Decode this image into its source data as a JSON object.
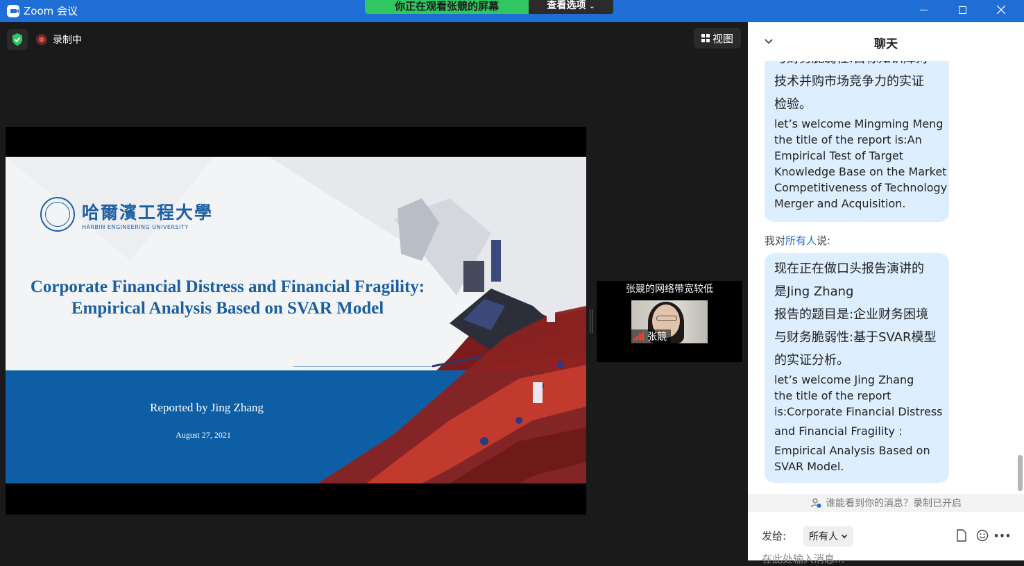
{
  "titlebar": {
    "app_title": "Zoom 会议",
    "share_banner": "你正在观看张競的屏幕",
    "view_options": "查看选项"
  },
  "toolbar": {
    "recording_label": "录制中",
    "view_label": "视图"
  },
  "slide": {
    "university_cn": "哈爾濱工程大學",
    "university_en": "HARBIN ENGINEERING UNIVERSITY",
    "title_line1": "Corporate Financial Distress and Financial Fragility:",
    "title_line2": "Empirical Analysis Based on SVAR Model",
    "reported_by": "Reported by Jing Zhang",
    "date": "August 27, 2021"
  },
  "participant": {
    "network_warning": "张競的网络带宽较低",
    "name": "张競"
  },
  "chat": {
    "title": "聊天",
    "message1_lines_cn": [
      "与财务脆弱性:目标知识库对",
      "技术并购市场竞争力的实证",
      "检验。"
    ],
    "message1_lines_en": [
      "let’s welcome Mingming Meng",
      "the title of the report is:An",
      "Empirical Test of Target",
      "Knowledge Base on the Market",
      "Competitiveness of Technology",
      "Merger and Acquisition."
    ],
    "sender_prefix": "我对",
    "sender_target": "所有人",
    "sender_suffix": "说:",
    "message2_lines_cn": [
      "现在正在做口头报告演讲的",
      "是Jing Zhang",
      "报告的题目是:企业财务困境",
      "与财务脆弱性:基于SVAR模型",
      "的实证分析。"
    ],
    "message2_lines_en": [
      "let’s welcome Jing Zhang",
      "the title of the report",
      "is:Corporate Financial Distress",
      "and Financial Fragility :",
      "Empirical Analysis Based on",
      "SVAR Model."
    ],
    "privacy_notice": "谁能看到你的消息？录制已开启",
    "send_to_label": "发给:",
    "recipient": "所有人",
    "input_placeholder": "在此处输入消息..."
  },
  "colors": {
    "titlebar_blue": "#1e6ed6",
    "share_green": "#2fc760",
    "bubble_blue": "#ddeeff",
    "slide_blue": "#0e5ea6"
  }
}
